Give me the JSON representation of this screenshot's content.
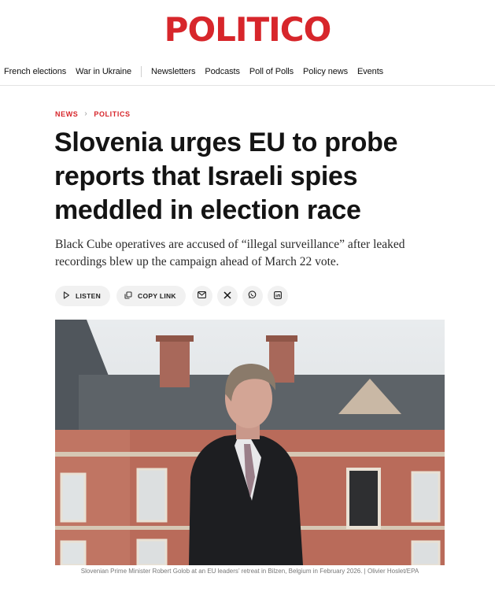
{
  "site": {
    "logo": "POLITICO",
    "brand_color": "#d7262b"
  },
  "nav": {
    "primary": [
      "French elections",
      "War in Ukraine"
    ],
    "secondary": [
      "Newsletters",
      "Podcasts",
      "Poll of Polls",
      "Policy news",
      "Events"
    ]
  },
  "breadcrumb": {
    "section": "NEWS",
    "subsection": "POLITICS"
  },
  "article": {
    "headline": "Slovenia urges EU to probe reports that Israeli spies meddled in election race",
    "dek": "Black Cube operatives are accused of “illegal surveillance” after leaked recordings blew up the campaign ahead of March 22 vote."
  },
  "share": {
    "listen_label": "LISTEN",
    "copy_link_label": "COPY LINK",
    "icons": [
      "email-icon",
      "x-icon",
      "whatsapp-icon",
      "linkedin-icon"
    ]
  },
  "photo": {
    "caption": "Slovenian Prime Minister Robert Golob at an EU leaders’ retreat in Bilzen, Belgium in February 2026. | Olivier Hoslet/EPA"
  }
}
